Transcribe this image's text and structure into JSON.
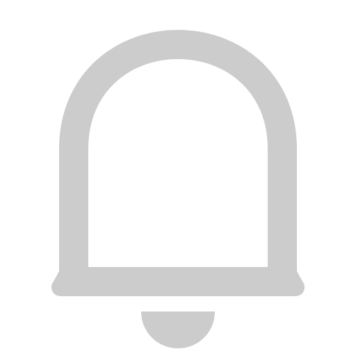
{
  "icon": {
    "name": "bell-icon",
    "color": "#cccccc"
  },
  "background": "#ffffff"
}
